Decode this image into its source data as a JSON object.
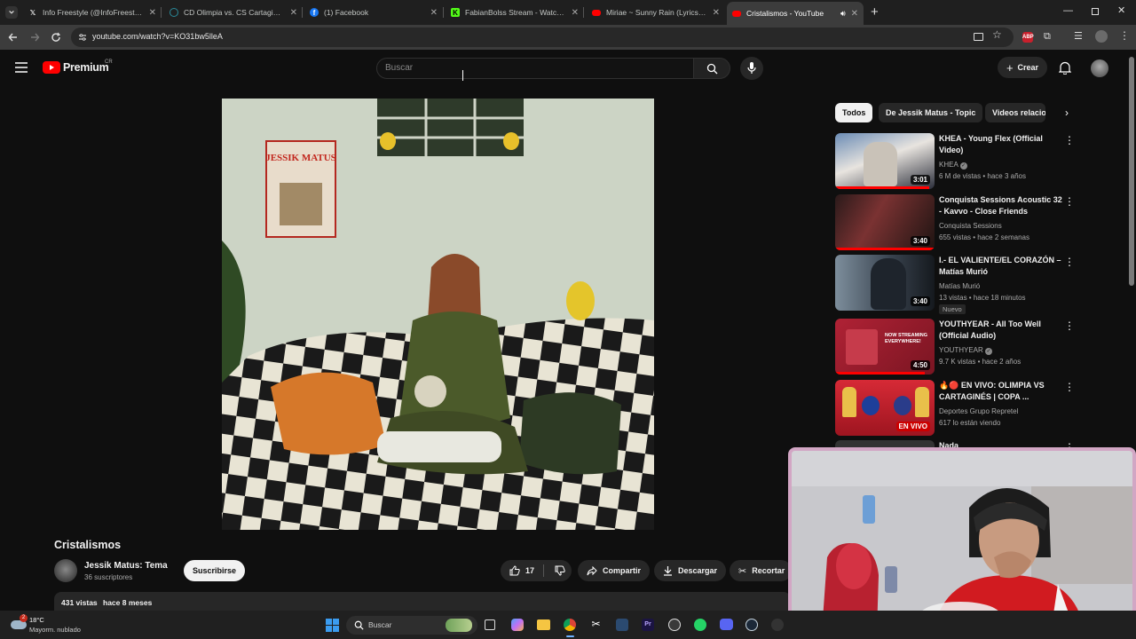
{
  "browser": {
    "tabs": [
      {
        "title": "Info Freestyle (@InfoFreestyle2",
        "icon": "x-icon"
      },
      {
        "title": "CD Olimpia vs. CS Cartaginés (C",
        "icon": "page-icon"
      },
      {
        "title": "(1) Facebook",
        "icon": "facebook-icon"
      },
      {
        "title": "FabianBolss Stream - Watch Liv",
        "icon": "kick-icon"
      },
      {
        "title": "Miriae ~ Sunny Rain (Lyrics vide",
        "icon": "youtube-icon"
      },
      {
        "title": "Cristalismos - YouTube",
        "icon": "youtube-icon",
        "active": true
      }
    ],
    "url": "youtube.com/watch?v=KO31bw5lleA"
  },
  "header": {
    "logo_text": "Premium",
    "country": "CR",
    "search_placeholder": "Buscar",
    "create_label": "Crear"
  },
  "video": {
    "title": "Cristalismos",
    "channel": "Jessik Matus: Tema",
    "subscribers": "36 suscriptores",
    "subscribe_label": "Suscribirse",
    "likes": "17",
    "share_label": "Compartir",
    "download_label": "Descargar",
    "clip_label": "Recortar",
    "views": "431 vistas",
    "age": "hace 8 meses",
    "poster_text": "JESSIK MATUS"
  },
  "chips": [
    "Todos",
    "De Jessik Matus - Topic",
    "Videos relacio"
  ],
  "recommendations": [
    {
      "title": "KHEA - Young Flex (Official Video)",
      "channel": "KHEA",
      "verified": true,
      "meta": "6 M de vistas • hace 3 años",
      "duration": "3:01",
      "progress": 0.95,
      "thumb_color": "#3b4a5e"
    },
    {
      "title": "Conquista Sessions Acoustic 32 - Kavvo - Close Friends",
      "channel": "Conquista Sessions",
      "verified": false,
      "meta": "655 vistas • hace 2 semanas",
      "duration": "3:40",
      "progress": 1.0,
      "thumb_color": "#4a2020"
    },
    {
      "title": "I.- EL VALIENTE/EL CORAZÓN – Matías Murió",
      "channel": "Matías Murió",
      "verified": false,
      "meta": "13 vistas • hace 18 minutos",
      "badge": "Nuevo",
      "duration": "3:40",
      "progress": 0,
      "thumb_color": "#5a6a7a"
    },
    {
      "title": "YOUTHYEAR - All Too Well (Official Audio)",
      "channel": "YOUTHYEAR",
      "verified": true,
      "meta": "9.7 K vistas • hace 2 años",
      "duration": "4:50",
      "progress": 0.9,
      "thumb_color": "#8a1a2a",
      "thumb_text": "NOW STREAMING EVERYWHERE!"
    },
    {
      "title": "🔥🔴 EN VIVO: OLIMPIA VS CARTAGINÉS | COPA ...",
      "channel": "Deportes Grupo Repretel",
      "verified": false,
      "meta": "617 lo están viendo",
      "duration": "EN VIVO",
      "live": true,
      "progress": 0,
      "thumb_color": "#c41e2a"
    },
    {
      "title": "Nada",
      "channel": "",
      "meta": "",
      "duration": "",
      "progress": 0,
      "thumb_color": "#333"
    }
  ],
  "taskbar": {
    "temperature": "18°C",
    "weather": "Mayorm. nublado",
    "weather_badge": "2",
    "search_placeholder": "Buscar"
  },
  "colors": {
    "yt_red": "#ff0000",
    "background": "#0f0f0f",
    "webcam_border": "#d2a6c4"
  }
}
